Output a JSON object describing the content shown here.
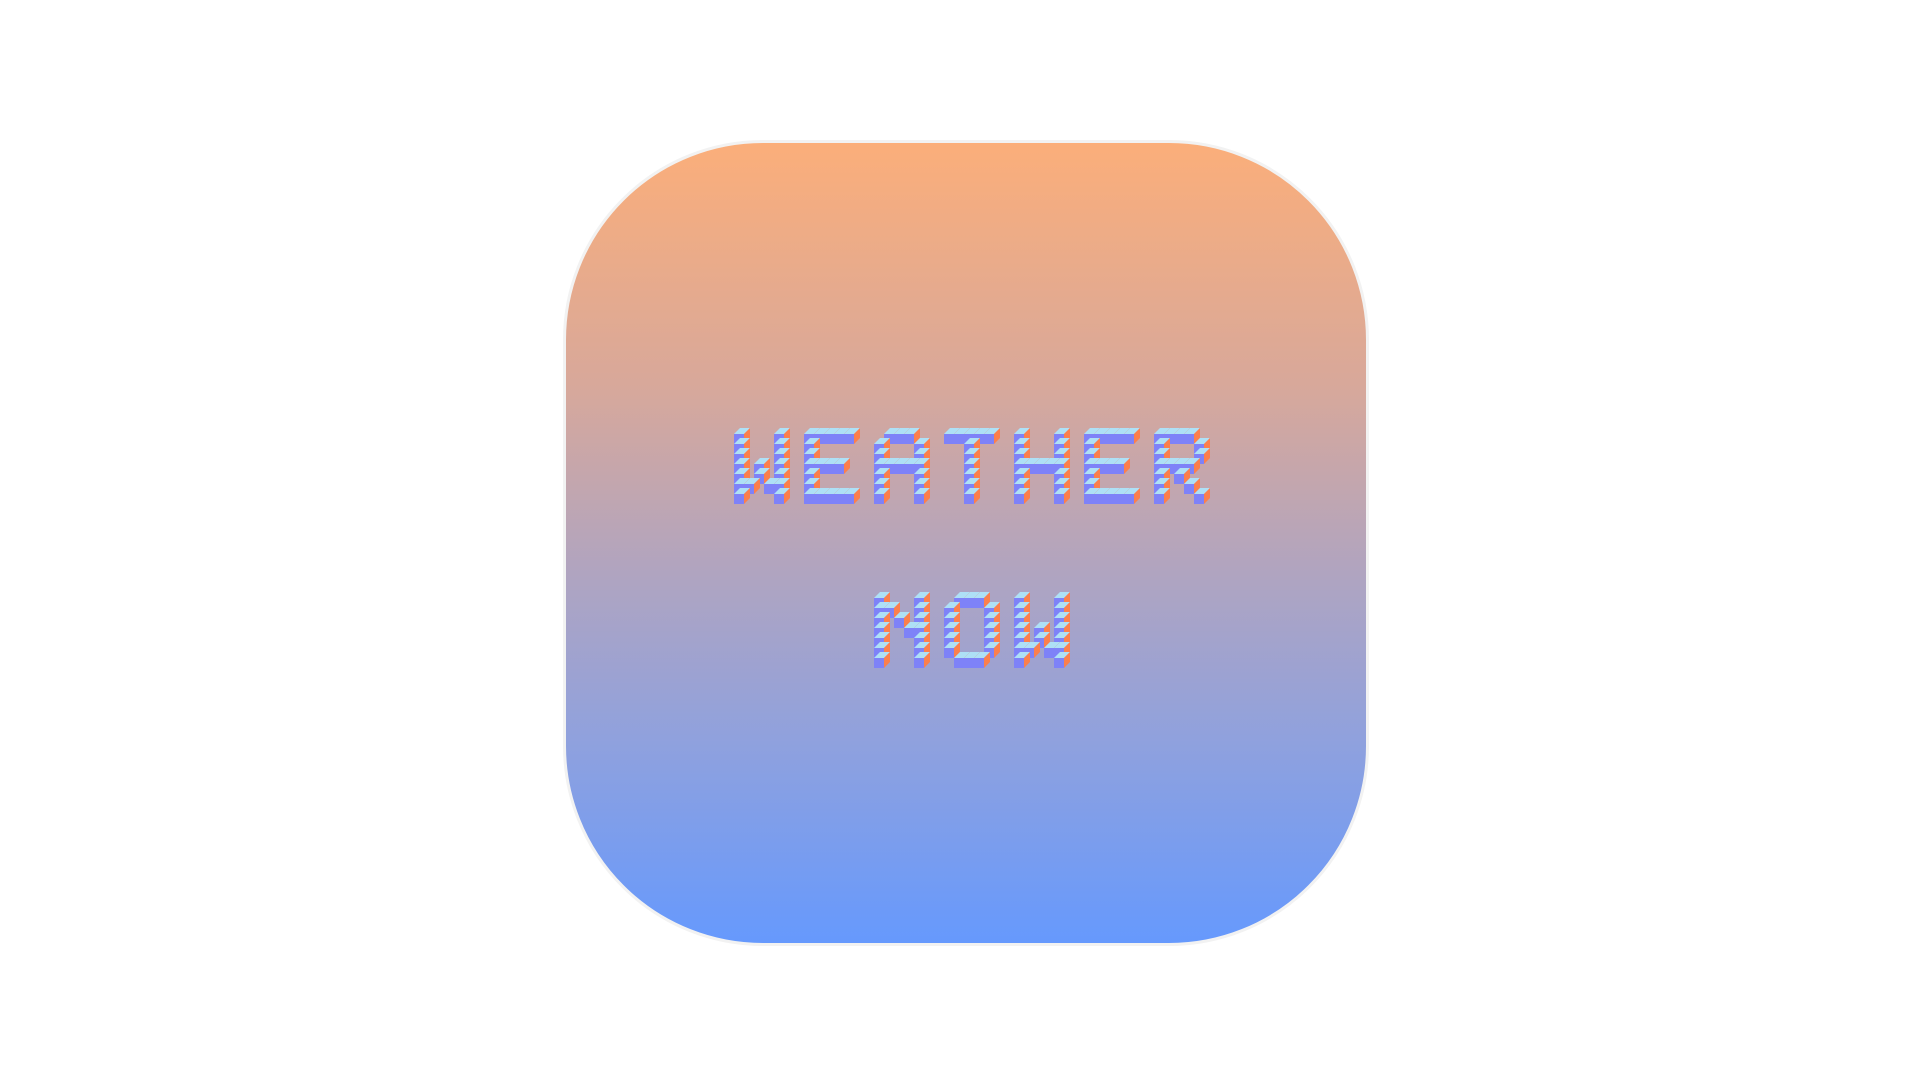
{
  "app_icon": {
    "title_lines": [
      "WEATHER",
      "NOW"
    ],
    "gradient_top": "#fbae7a",
    "gradient_bottom": "#6699fd",
    "colors": {
      "top_face": "#aee0f6",
      "left_face": "#7e82f8",
      "right_face": "#fb7f4d"
    }
  }
}
